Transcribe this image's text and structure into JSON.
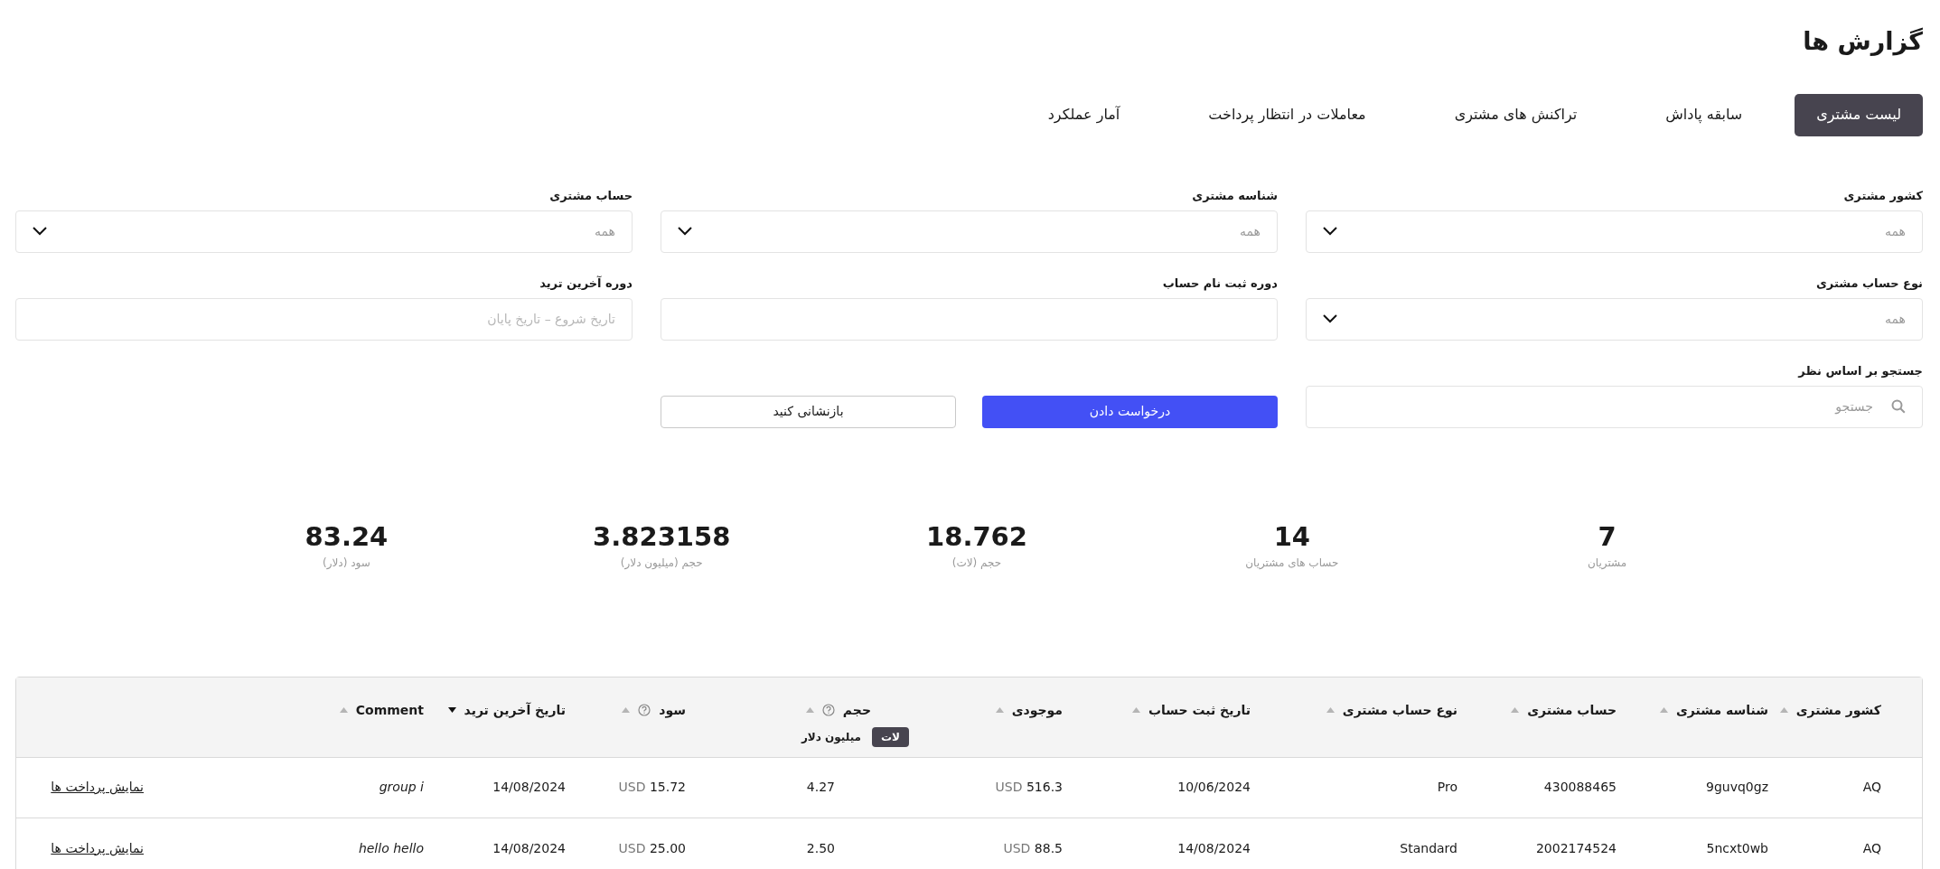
{
  "page": {
    "title": "گزارش ها"
  },
  "tabs": [
    {
      "label": "لیست مشتری",
      "selected": true
    },
    {
      "label": "سابقه پاداش",
      "selected": false
    },
    {
      "label": "تراکنش های مشتری",
      "selected": false
    },
    {
      "label": "معاملات در انتظار پرداخت",
      "selected": false
    },
    {
      "label": "آمار عملکرد",
      "selected": false
    }
  ],
  "filters": [
    {
      "kind": "select",
      "label": "کشور مشتری",
      "placeholder": "همه"
    },
    {
      "kind": "select",
      "label": "شناسه مشتری",
      "placeholder": "همه"
    },
    {
      "kind": "select",
      "label": "حساب مشتری",
      "placeholder": "همه"
    },
    {
      "kind": "select",
      "label": "نوع حساب مشتری",
      "placeholder": "همه"
    },
    {
      "kind": "text",
      "label": "دوره ثبت نام حساب"
    },
    {
      "kind": "daterange",
      "label": "دوره آخرین ترید",
      "placeholder": "تاریخ شروع – تاریخ پایان"
    },
    {
      "kind": "search",
      "label": "جستجو بر اساس نظر",
      "placeholder": "جستجو"
    }
  ],
  "buttons": [
    {
      "kind": "primary",
      "label": "درخواست دادن"
    },
    {
      "kind": "secondary",
      "label": "بازنشانی کنید"
    }
  ],
  "stats": [
    {
      "value": "7",
      "label": "مشتریان"
    },
    {
      "value": "14",
      "label": "حساب های مشتریان"
    },
    {
      "value": "18.762",
      "label": "حجم (لات)"
    },
    {
      "value": "3.823158",
      "label": "حجم (میلیون دلار)"
    },
    {
      "value": "83.24",
      "label": "سود (دلار)"
    }
  ],
  "table": {
    "columns": [
      {
        "label": "کشور مشتری",
        "sorted": false,
        "help": false,
        "kind": "text"
      },
      {
        "label": "شناسه مشتری",
        "sorted": false,
        "help": false,
        "kind": "text"
      },
      {
        "label": "حساب مشتری",
        "sorted": false,
        "help": false,
        "kind": "text"
      },
      {
        "label": "نوع حساب مشتری",
        "sorted": false,
        "help": false,
        "kind": "text"
      },
      {
        "label": "تاریخ ثبت حساب",
        "sorted": false,
        "help": false,
        "kind": "text"
      },
      {
        "label": "موجودی",
        "sorted": false,
        "help": false,
        "kind": "money"
      },
      {
        "label": "حجم",
        "sorted": false,
        "help": true,
        "kind": "number",
        "units": [
          {
            "label": "لات",
            "selected": true
          },
          {
            "label": "میلیون دلار",
            "selected": false
          }
        ]
      },
      {
        "label": "سود",
        "sorted": false,
        "help": true,
        "kind": "money"
      },
      {
        "label": "تاریخ آخرین ترید",
        "sorted": true,
        "help": false,
        "kind": "text"
      },
      {
        "label": "Comment",
        "sorted": false,
        "help": false,
        "kind": "comment"
      },
      {
        "kind": "link"
      }
    ],
    "rows": [
      {
        "cells": [
          "AQ",
          "9guvq0gz",
          "430088465",
          "Pro",
          "10/06/2024",
          {
            "currency": "USD",
            "value": "516.3"
          },
          "4.27",
          {
            "currency": "USD",
            "value": "15.72"
          },
          "14/08/2024",
          "group i",
          "نمایش پرداخت ها"
        ]
      },
      {
        "cells": [
          "AQ",
          "5ncxt0wb",
          "2002174524",
          "Standard",
          "14/08/2024",
          {
            "currency": "USD",
            "value": "88.5"
          },
          "2.50",
          {
            "currency": "USD",
            "value": "25.00"
          },
          "14/08/2024",
          "hello hello",
          "نمایش پرداخت ها"
        ]
      }
    ]
  }
}
